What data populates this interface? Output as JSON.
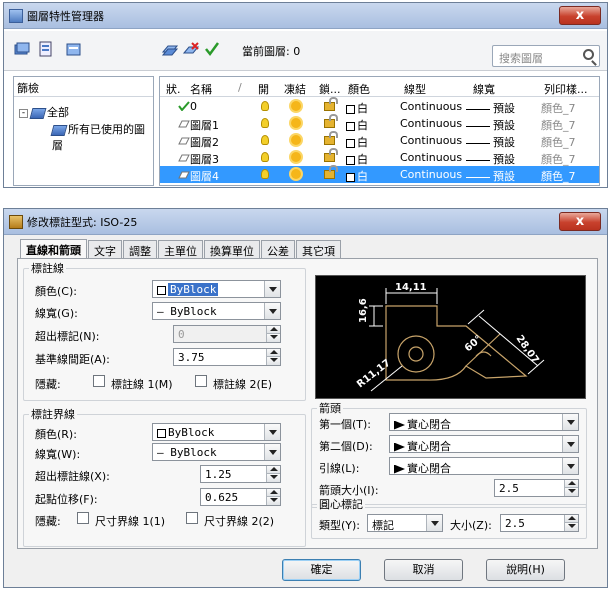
{
  "layer_manager": {
    "title": "圖層特性管理器",
    "close_label": "x",
    "current_layer_label": "當前圖層: 0",
    "search_placeholder": "搜索圖層",
    "filter_header": "篩檢",
    "tree_root": "全部",
    "tree_child": "所有已使用的圖層",
    "columns": [
      "狀.",
      "名稱",
      "/",
      "開",
      "凍結",
      "鎖...",
      "顏色",
      "線型",
      "線寬",
      "列印樣..."
    ],
    "rows": [
      {
        "name": "0",
        "color": "白",
        "linetype": "Continuous",
        "lineweight": "預設",
        "plotstyle": "顏色_7",
        "selected": false
      },
      {
        "name": "圖層1",
        "color": "白",
        "linetype": "Continuous",
        "lineweight": "預設",
        "plotstyle": "顏色_7",
        "selected": false
      },
      {
        "name": "圖層2",
        "color": "白",
        "linetype": "Continuous",
        "lineweight": "預設",
        "plotstyle": "顏色_7",
        "selected": false
      },
      {
        "name": "圖層3",
        "color": "白",
        "linetype": "Continuous",
        "lineweight": "預設",
        "plotstyle": "顏色_7",
        "selected": false
      },
      {
        "name": "圖層4",
        "color": "白",
        "linetype": "Continuous",
        "lineweight": "預設",
        "plotstyle": "顏色_7",
        "selected": true
      }
    ]
  },
  "dimstyle": {
    "title": "修改標註型式: ISO-25",
    "close_label": "x",
    "tabs": [
      "直線和箭頭",
      "文字",
      "調整",
      "主單位",
      "換算單位",
      "公差",
      "其它項"
    ],
    "dimline": {
      "group": "標註線",
      "color_label": "顏色(C):",
      "color_value": "ByBlock",
      "lw_label": "線寬(G):",
      "lw_value": "— ByBlock",
      "ext_label": "超出標記(N):",
      "ext_value": "0",
      "base_label": "基準線間距(A):",
      "base_value": "3.75",
      "suppress_label": "隱藏:",
      "sup1": "標註線 1(M)",
      "sup2": "標註線 2(E)"
    },
    "extline": {
      "group": "標註界線",
      "color_label": "顏色(R):",
      "color_value": "ByBlock",
      "lw_label": "線寬(W):",
      "lw_value": "— ByBlock",
      "ext_label": "超出標註線(X):",
      "ext_value": "1.25",
      "offset_label": "起點位移(F):",
      "offset_value": "0.625",
      "suppress_label": "隱藏:",
      "sup1": "尺寸界線 1(1)",
      "sup2": "尺寸界線 2(2)"
    },
    "arrows": {
      "group": "箭頭",
      "first_label": "第一個(T):",
      "first_value": "實心閉合",
      "second_label": "第二個(D):",
      "second_value": "實心閉合",
      "leader_label": "引線(L):",
      "leader_value": "實心閉合",
      "size_label": "箭頭大小(I):",
      "size_value": "2.5"
    },
    "center": {
      "group": "圓心標記",
      "type_label": "類型(Y):",
      "type_value": "標記",
      "size_label": "大小(Z):",
      "size_value": "2.5"
    },
    "preview": {
      "d1": "14,11",
      "d2": "16,6",
      "d3": "28,07",
      "d4": "R11,17",
      "d5": "60°"
    },
    "buttons": {
      "ok": "確定",
      "cancel": "取消",
      "help": "說明(H)"
    }
  },
  "colors": {
    "accent": "#3399ff",
    "title_bar": "#b9cce8",
    "close": "#c8412d",
    "preview_line": "#c8a46a"
  }
}
